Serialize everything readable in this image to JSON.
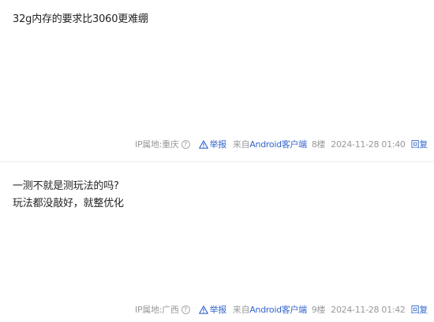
{
  "posts": [
    {
      "lines": [
        "32g内存的要求比3060更难绷"
      ],
      "ip_label": "IP属地:重庆",
      "help_glyph": "?",
      "report": "举报",
      "from_prefix": "来自",
      "client": "Android客户端",
      "floor": "8楼",
      "time": "2024-11-28 01:40",
      "reply": "回复"
    },
    {
      "lines": [
        "一测不就是测玩法的吗?",
        "玩法都没敲好，就整优化"
      ],
      "ip_label": "IP属地:广西",
      "help_glyph": "?",
      "report": "举报",
      "from_prefix": "来自",
      "client": "Android客户端",
      "floor": "9楼",
      "time": "2024-11-28 01:42",
      "reply": "回复"
    }
  ],
  "colors": {
    "text": "#222222",
    "meta": "#999999",
    "link": "#3366cc",
    "divider": "#eeeeee"
  },
  "icons": {
    "report": "warning-triangle-icon",
    "help": "question-circle-icon"
  }
}
